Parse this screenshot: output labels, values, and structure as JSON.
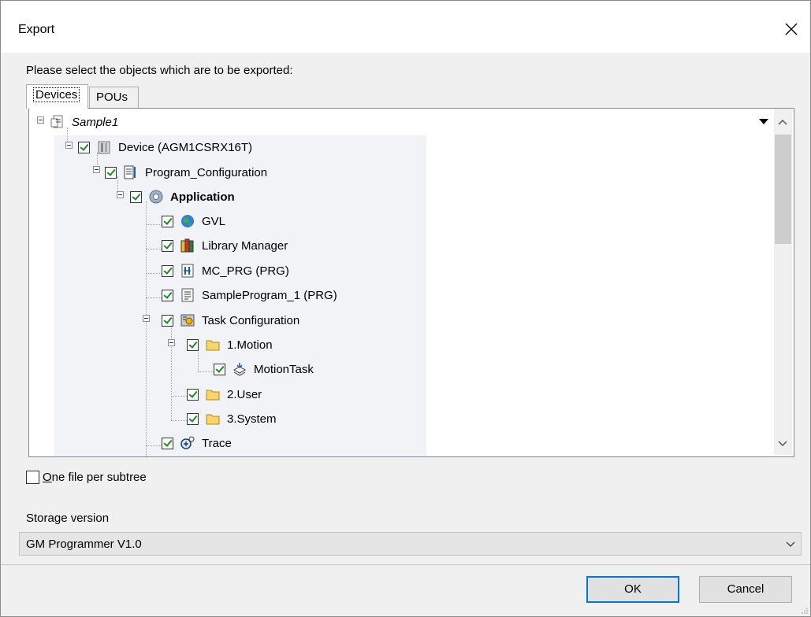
{
  "window": {
    "title": "Export"
  },
  "prompt": "Please select the objects which are to be exported:",
  "tabs": [
    {
      "label": "Devices",
      "active": true
    },
    {
      "label": "POUs",
      "active": false
    }
  ],
  "tree": {
    "root": {
      "label": "Sample1",
      "icon": "project-icon"
    },
    "items": [
      {
        "label": "Device (AGM1CSRX16T)",
        "icon": "device-icon",
        "checked": true
      },
      {
        "label": "Program_Configuration",
        "icon": "program-config-icon",
        "checked": true
      },
      {
        "label": "Application",
        "icon": "application-gear-icon",
        "checked": true,
        "bold": true
      },
      {
        "label": "GVL",
        "icon": "globe-icon",
        "checked": true
      },
      {
        "label": "Library Manager",
        "icon": "library-books-icon",
        "checked": true
      },
      {
        "label": "MC_PRG (PRG)",
        "icon": "program-ladder-icon",
        "checked": true
      },
      {
        "label": "SampleProgram_1 (PRG)",
        "icon": "program-document-icon",
        "checked": true
      },
      {
        "label": "Task Configuration",
        "icon": "task-config-icon",
        "checked": true
      },
      {
        "label": "1.Motion",
        "icon": "folder-icon",
        "checked": true
      },
      {
        "label": "MotionTask",
        "icon": "task-icon",
        "checked": true
      },
      {
        "label": "2.User",
        "icon": "folder-icon",
        "checked": true
      },
      {
        "label": "3.System",
        "icon": "folder-icon",
        "checked": true
      },
      {
        "label": "Trace",
        "icon": "trace-icon",
        "checked": true
      }
    ]
  },
  "options": {
    "one_file_label_u": "O",
    "one_file_label_rest": "ne file per subtree",
    "one_file_checked": false
  },
  "storage": {
    "label": "Storage version",
    "value": "GM Programmer V1.0"
  },
  "buttons": {
    "ok": "OK",
    "cancel": "Cancel"
  }
}
